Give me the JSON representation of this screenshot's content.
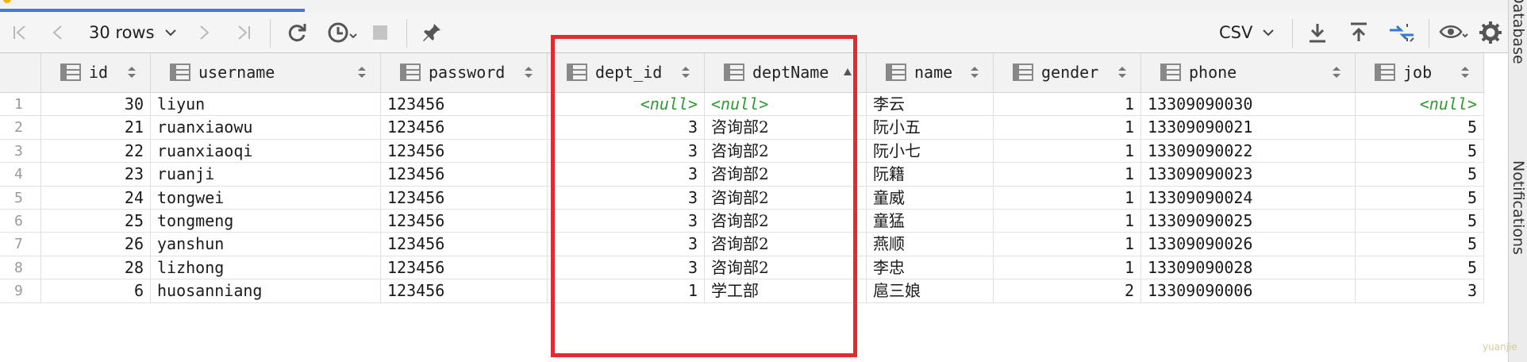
{
  "toolbar": {
    "rows_label": "30 rows",
    "export_format": "CSV",
    "icons": [
      "first-page-icon",
      "prev-page-icon",
      "next-page-icon",
      "last-page-icon",
      "refresh-icon",
      "history-icon",
      "stop-icon",
      "pin-icon",
      "download-icon",
      "upload-icon",
      "compare-icon",
      "eye-icon",
      "gear-icon"
    ]
  },
  "side_panel": {
    "labels": [
      "Database",
      "Notifications"
    ]
  },
  "table": {
    "columns": [
      "id",
      "username",
      "password",
      "dept_id",
      "deptName",
      "name",
      "gender",
      "phone",
      "job"
    ],
    "sorted_column": "deptName",
    "null_text": "<null>",
    "rows": [
      {
        "n": "1",
        "id": "30",
        "username": "liyun",
        "password": "123456",
        "dept_id": "<null>",
        "deptName": "<null>",
        "name": "李云",
        "gender": "1",
        "phone": "13309090030",
        "job": "<null>"
      },
      {
        "n": "2",
        "id": "21",
        "username": "ruanxiaowu",
        "password": "123456",
        "dept_id": "3",
        "deptName": "咨询部2",
        "name": "阮小五",
        "gender": "1",
        "phone": "13309090021",
        "job": "5"
      },
      {
        "n": "3",
        "id": "22",
        "username": "ruanxiaoqi",
        "password": "123456",
        "dept_id": "3",
        "deptName": "咨询部2",
        "name": "阮小七",
        "gender": "1",
        "phone": "13309090022",
        "job": "5"
      },
      {
        "n": "4",
        "id": "23",
        "username": "ruanji",
        "password": "123456",
        "dept_id": "3",
        "deptName": "咨询部2",
        "name": "阮籍",
        "gender": "1",
        "phone": "13309090023",
        "job": "5"
      },
      {
        "n": "5",
        "id": "24",
        "username": "tongwei",
        "password": "123456",
        "dept_id": "3",
        "deptName": "咨询部2",
        "name": "童威",
        "gender": "1",
        "phone": "13309090024",
        "job": "5"
      },
      {
        "n": "6",
        "id": "25",
        "username": "tongmeng",
        "password": "123456",
        "dept_id": "3",
        "deptName": "咨询部2",
        "name": "童猛",
        "gender": "1",
        "phone": "13309090025",
        "job": "5"
      },
      {
        "n": "7",
        "id": "26",
        "username": "yanshun",
        "password": "123456",
        "dept_id": "3",
        "deptName": "咨询部2",
        "name": "燕顺",
        "gender": "1",
        "phone": "13309090026",
        "job": "5"
      },
      {
        "n": "8",
        "id": "28",
        "username": "lizhong",
        "password": "123456",
        "dept_id": "3",
        "deptName": "咨询部2",
        "name": "李忠",
        "gender": "1",
        "phone": "13309090028",
        "job": "5"
      },
      {
        "n": "9",
        "id": "6",
        "username": "huosanniang",
        "password": "123456",
        "dept_id": "1",
        "deptName": "学工部",
        "name": "扈三娘",
        "gender": "2",
        "phone": "13309090006",
        "job": "3"
      }
    ]
  },
  "colors": {
    "highlight": "#e12b30",
    "null_text": "#2f9a2f"
  }
}
